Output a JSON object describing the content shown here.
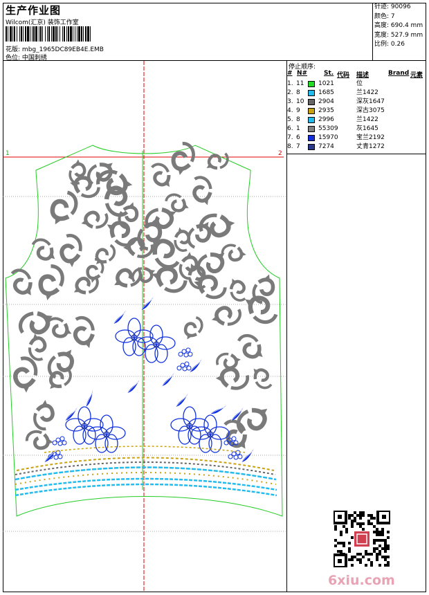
{
  "header": {
    "title": "生产作业图",
    "studio": "Wilcom(汇京) 装饰工作室",
    "design_label": "花版:",
    "design_value": "mbg_1965DC89EB4E.EMB",
    "color_label": "色位:",
    "color_value": "中国刺绣"
  },
  "stats": [
    {
      "label": "针迹:",
      "value": "90096"
    },
    {
      "label": "颜色:",
      "value": "7"
    },
    {
      "label": "高度:",
      "value": "690.4 mm"
    },
    {
      "label": "宽度:",
      "value": "527.9 mm"
    },
    {
      "label": "比例:",
      "value": "0.26"
    }
  ],
  "panel": {
    "title": "停止顺序:",
    "columns": [
      "#",
      "N#",
      "St.",
      "代码",
      "描述",
      "Brand",
      "元素"
    ],
    "rows": [
      {
        "num": "1.",
        "n": "11",
        "color": "#22dd22",
        "code": "1021",
        "desc": "位"
      },
      {
        "num": "2.",
        "n": "8",
        "color": "#22bbee",
        "code": "1685",
        "desc": "兰1422"
      },
      {
        "num": "3.",
        "n": "10",
        "color": "#666666",
        "code": "2904",
        "desc": "深灰1647"
      },
      {
        "num": "4.",
        "n": "9",
        "color": "#c8a010",
        "code": "2935",
        "desc": "深古3075"
      },
      {
        "num": "5.",
        "n": "8",
        "color": "#22bbee",
        "code": "2996",
        "desc": "兰1422"
      },
      {
        "num": "6.",
        "n": "1",
        "color": "#808080",
        "code": "55309",
        "desc": "灰1645"
      },
      {
        "num": "7.",
        "n": "6",
        "color": "#1030e0",
        "code": "15970",
        "desc": "宝兰2192"
      },
      {
        "num": "8.",
        "n": "7",
        "color": "#2a3a8a",
        "code": "7274",
        "desc": "丈青1272"
      }
    ]
  },
  "canvas": {
    "marker_left": "1",
    "marker_right": "2"
  },
  "watermark": {
    "brand": "6xiu.com"
  }
}
